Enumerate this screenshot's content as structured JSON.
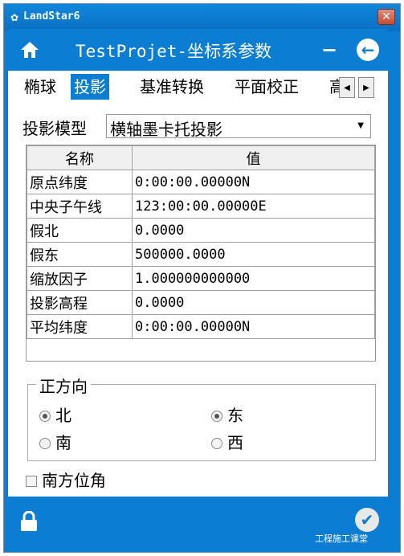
{
  "window": {
    "title": "LandStar6",
    "close": "✕"
  },
  "appbar": {
    "title": "TestProjet-坐标系参数",
    "minimize": "−",
    "back": "←"
  },
  "tabs": [
    {
      "label": "椭球"
    },
    {
      "label": "投影"
    },
    {
      "label": "基准转换"
    },
    {
      "label": "平面校正"
    },
    {
      "label": "高"
    }
  ],
  "active_tab": "投影",
  "projection": {
    "label": "投影模型",
    "value": "横轴墨卡托投影"
  },
  "table": {
    "headers": [
      "名称",
      "值"
    ],
    "rows": [
      [
        "原点纬度",
        "0:00:00.00000N"
      ],
      [
        "中央子午线",
        "123:00:00.00000E"
      ],
      [
        "假北",
        "0.0000"
      ],
      [
        "假东",
        "500000.0000"
      ],
      [
        "缩放因子",
        "1.000000000000"
      ],
      [
        "投影高程",
        "0.0000"
      ],
      [
        "平均纬度",
        "0:00:00.00000N"
      ]
    ]
  },
  "direction": {
    "legend": "正方向",
    "options": [
      {
        "label": "北",
        "checked": true
      },
      {
        "label": "东",
        "checked": true
      },
      {
        "label": "南",
        "checked": false
      },
      {
        "label": "西",
        "checked": false
      }
    ]
  },
  "south_azimuth": {
    "label": "南方位角",
    "checked": false
  },
  "watermark": "工程施工课堂",
  "colors": {
    "accent": "#0b7ed4"
  }
}
